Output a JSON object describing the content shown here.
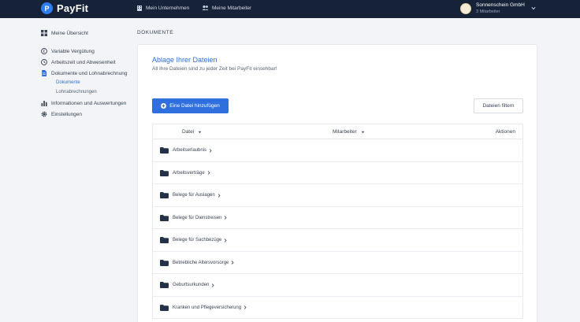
{
  "topbar": {
    "logo_letter": "P",
    "logo_text": "PayFit",
    "nav": [
      {
        "label": "Mein Unternehmen",
        "icon": "building-icon"
      },
      {
        "label": "Meine Mitarbeiter",
        "icon": "people-icon"
      }
    ],
    "account": {
      "name": "Sonnenschein GmbH",
      "sub": "3 Mitarbeiter"
    }
  },
  "sidebar": {
    "items": [
      {
        "label": "Meine Übersicht",
        "icon": "dashboard-icon"
      },
      {
        "label": "Variable Vergütung",
        "icon": "euro-icon"
      },
      {
        "label": "Arbeitszeit und Abwesenheit",
        "icon": "clock-icon"
      },
      {
        "label": "Dokumente und Lohnabrechnung",
        "icon": "document-icon"
      },
      {
        "label": "Informationen und Auswertungen",
        "icon": "chart-icon"
      },
      {
        "label": "Einstellungen",
        "icon": "gear-icon"
      }
    ],
    "subitems": [
      {
        "label": "Dokumente",
        "active": true
      },
      {
        "label": "Lohnabrechnungen",
        "active": false
      }
    ]
  },
  "main": {
    "section_label": "DOKUMENTE",
    "card_title": "Ablage Ihrer Dateien",
    "card_subtitle": "All Ihre Dateien sind zu jeder Zeit bei PayFit einsehbar!",
    "add_button": "Eine Datei hinzufügen",
    "filter_button": "Dateien filtern",
    "table": {
      "columns": [
        "Datei",
        "Mitarbeiter",
        "Aktionen"
      ],
      "rows": [
        "Arbeitserlaubnis",
        "Arbeitsverträge",
        "Belege für Auslagen",
        "Belege für Dienstreisen",
        "Belege für Sachbezüge",
        "Betriebliche Altersvorsorge",
        "Geburtsurkunden",
        "Kranken und Pflegeversicherung"
      ]
    }
  },
  "colors": {
    "topbar": "#152237",
    "accent": "#2f6fde",
    "background": "#f3f4f7"
  }
}
